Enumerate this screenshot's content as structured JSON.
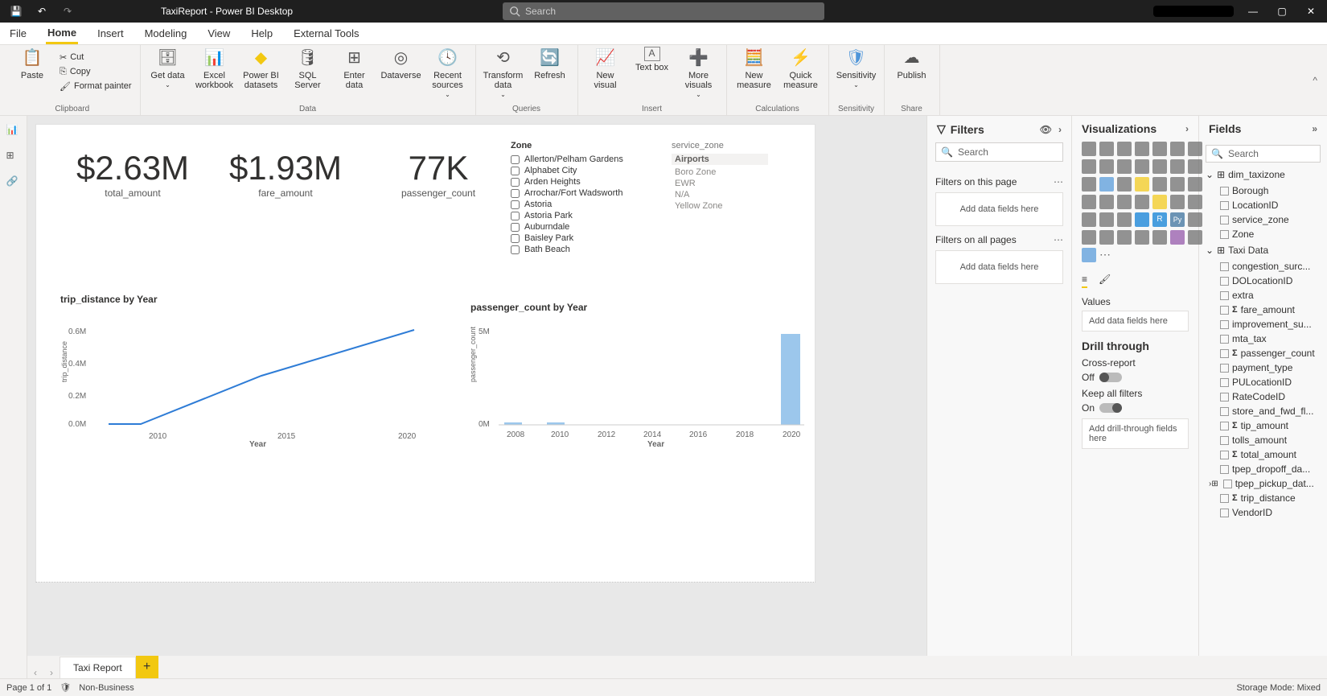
{
  "titlebar": {
    "title": "TaxiReport - Power BI Desktop",
    "search_placeholder": "Search"
  },
  "menu": {
    "items": [
      "File",
      "Home",
      "Insert",
      "Modeling",
      "View",
      "Help",
      "External Tools"
    ],
    "active": "Home"
  },
  "ribbon": {
    "clipboard": {
      "paste": "Paste",
      "cut": "Cut",
      "copy": "Copy",
      "format_painter": "Format painter",
      "label": "Clipboard"
    },
    "data": {
      "get_data": "Get data",
      "excel": "Excel workbook",
      "pbi": "Power BI datasets",
      "sql": "SQL Server",
      "enter": "Enter data",
      "dataverse": "Dataverse",
      "recent": "Recent sources",
      "label": "Data"
    },
    "queries": {
      "transform": "Transform data",
      "refresh": "Refresh",
      "label": "Queries"
    },
    "insert": {
      "new_visual": "New visual",
      "text_box": "Text box",
      "more": "More visuals",
      "label": "Insert"
    },
    "calc": {
      "new_measure": "New measure",
      "quick": "Quick measure",
      "label": "Calculations"
    },
    "sensitivity": {
      "btn": "Sensitivity",
      "label": "Sensitivity"
    },
    "share": {
      "publish": "Publish",
      "label": "Share"
    }
  },
  "cards": {
    "total_amount": {
      "value": "$2.63M",
      "label": "total_amount"
    },
    "fare_amount": {
      "value": "$1.93M",
      "label": "fare_amount"
    },
    "passenger_count": {
      "value": "77K",
      "label": "passenger_count"
    }
  },
  "zone_slicer": {
    "title": "Zone",
    "items": [
      "Allerton/Pelham Gardens",
      "Alphabet City",
      "Arden Heights",
      "Arrochar/Fort Wadsworth",
      "Astoria",
      "Astoria Park",
      "Auburndale",
      "Baisley Park",
      "Bath Beach"
    ]
  },
  "service_zone": {
    "title": "service_zone",
    "items": [
      "Airports",
      "Boro Zone",
      "EWR",
      "N/A",
      "Yellow Zone"
    ]
  },
  "filters": {
    "title": "Filters",
    "search": "Search",
    "on_page": "Filters on this page",
    "on_all": "Filters on all pages",
    "drop": "Add data fields here"
  },
  "viz": {
    "title": "Visualizations",
    "values": "Values",
    "drop": "Add data fields here",
    "drill": "Drill through",
    "cross": "Cross-report",
    "off": "Off",
    "keep": "Keep all filters",
    "on": "On",
    "drill_drop": "Add drill-through fields here"
  },
  "fields": {
    "title": "Fields",
    "search": "Search",
    "tables": [
      {
        "name": "dim_taxizone",
        "expanded": true,
        "cols": [
          {
            "name": "Borough"
          },
          {
            "name": "LocationID"
          },
          {
            "name": "service_zone"
          },
          {
            "name": "Zone"
          }
        ]
      },
      {
        "name": "Taxi Data",
        "expanded": true,
        "cols": [
          {
            "name": "congestion_surc..."
          },
          {
            "name": "DOLocationID"
          },
          {
            "name": "extra"
          },
          {
            "name": "fare_amount",
            "agg": true
          },
          {
            "name": "improvement_su..."
          },
          {
            "name": "mta_tax"
          },
          {
            "name": "passenger_count",
            "agg": true
          },
          {
            "name": "payment_type"
          },
          {
            "name": "PULocationID"
          },
          {
            "name": "RateCodeID"
          },
          {
            "name": "store_and_fwd_fl..."
          },
          {
            "name": "tip_amount",
            "agg": true
          },
          {
            "name": "tolls_amount"
          },
          {
            "name": "total_amount",
            "agg": true
          },
          {
            "name": "tpep_dropoff_da..."
          },
          {
            "name": "tpep_pickup_dat...",
            "hier": true
          },
          {
            "name": "trip_distance",
            "agg": true
          },
          {
            "name": "VendorID"
          }
        ]
      }
    ]
  },
  "pagetab": {
    "name": "Taxi Report"
  },
  "status": {
    "page": "Page 1 of 1",
    "class": "Non-Business",
    "storage": "Storage Mode: Mixed"
  },
  "chart_data": [
    {
      "type": "line",
      "title": "trip_distance by Year",
      "xlabel": "Year",
      "ylabel": "trip_distance",
      "categories": [
        2008,
        2010,
        2015,
        2020
      ],
      "values": [
        0,
        0,
        300000,
        600000
      ],
      "ylim": [
        0,
        600000
      ],
      "yticks": [
        "0.0M",
        "0.2M",
        "0.4M",
        "0.6M"
      ],
      "xticks": [
        "2010",
        "2015",
        "2020"
      ]
    },
    {
      "type": "bar",
      "title": "passenger_count by Year",
      "xlabel": "Year",
      "ylabel": "passenger_count",
      "categories": [
        2008,
        2010,
        2012,
        2014,
        2016,
        2018,
        2020
      ],
      "values": [
        100000,
        100000,
        0,
        0,
        0,
        0,
        5000000
      ],
      "ylim": [
        0,
        5000000
      ],
      "yticks": [
        "0M",
        "5M"
      ],
      "xticks": [
        "2008",
        "2010",
        "2012",
        "2014",
        "2016",
        "2018",
        "2020"
      ]
    }
  ]
}
